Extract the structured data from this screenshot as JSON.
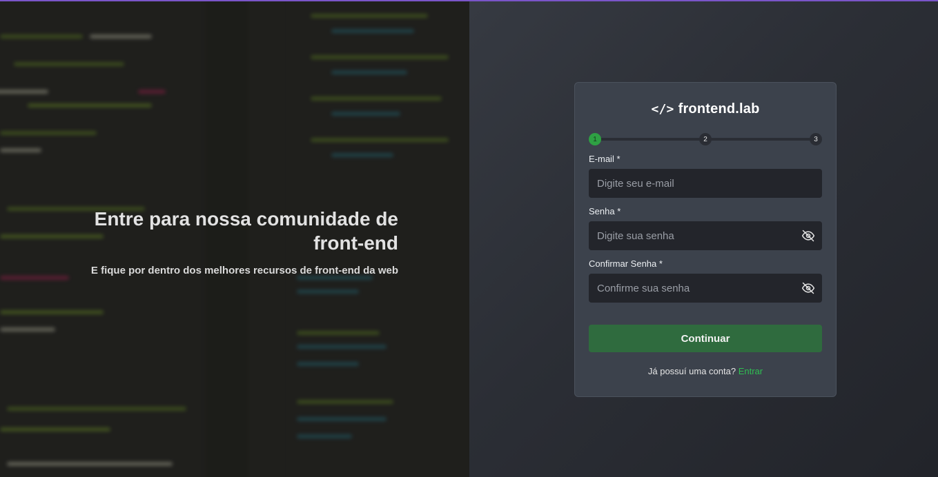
{
  "hero": {
    "title": "Entre para nossa comunidade de front-end",
    "subtitle": "E fique por dentro dos melhores recursos de front-end da web"
  },
  "logo": {
    "mark": "</>",
    "text": "frontend.lab"
  },
  "stepper": {
    "steps": [
      "1",
      "2",
      "3"
    ],
    "current": 1
  },
  "form": {
    "email": {
      "label": "E-mail *",
      "placeholder": "Digite seu e-mail",
      "value": ""
    },
    "password": {
      "label": "Senha *",
      "placeholder": "Digite sua senha",
      "value": "",
      "icon": "eye-off-icon"
    },
    "confirm": {
      "label": "Confirmar Senha *",
      "placeholder": "Confirme sua senha",
      "value": "",
      "icon": "eye-off-icon"
    },
    "submit_label": "Continuar"
  },
  "login": {
    "prompt": "Já possuí uma conta?",
    "link": "Entrar"
  },
  "colors": {
    "accent": "#2ea043",
    "button": "#2f6b3e",
    "link": "#2fbf52",
    "card": "#3c424c",
    "top_bar": "#7a55c9"
  }
}
